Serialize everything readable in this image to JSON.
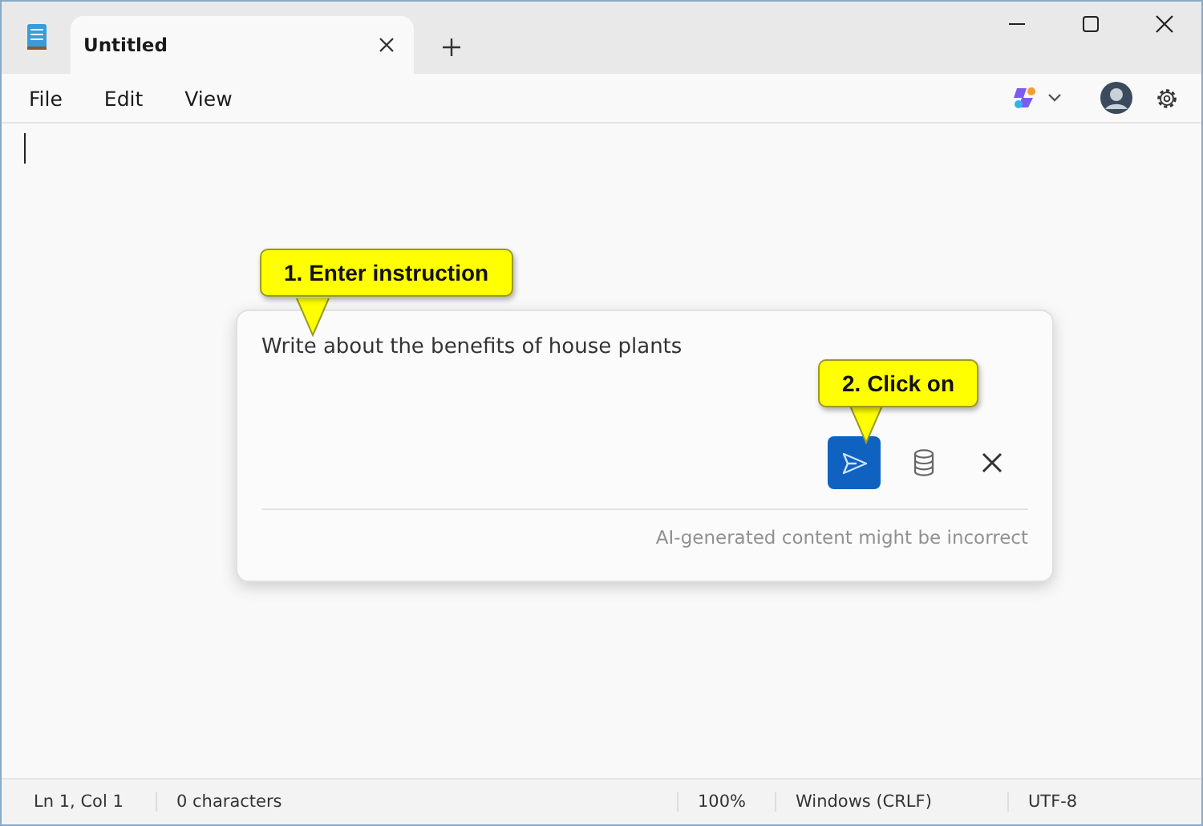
{
  "tab": {
    "title": "Untitled",
    "selected": true
  },
  "menu": [
    "File",
    "Edit",
    "View"
  ],
  "prompt": {
    "value": "Write about the benefits of house plants",
    "disclaimer": "AI-generated content might be incorrect"
  },
  "callouts": [
    {
      "text": "1. Enter instruction"
    },
    {
      "text": "2. Click on"
    }
  ],
  "status_bar": [
    "Ln 1, Col 1",
    "0 characters",
    "100%",
    "Windows (CRLF)",
    "UTF-8"
  ]
}
